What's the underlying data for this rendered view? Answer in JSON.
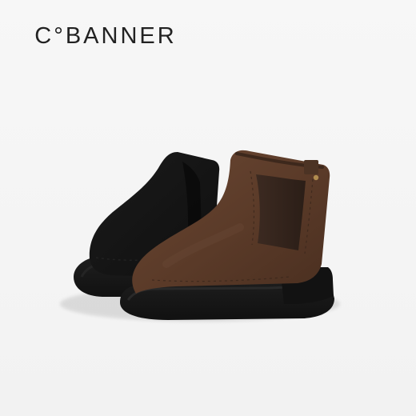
{
  "brand": {
    "logo_text": "C°BANNER"
  },
  "photo": {
    "subject": "product-photo",
    "background_color": "#f6f6f6",
    "boot_colors": {
      "black": "#121212",
      "brown": "#5a3a28",
      "sole": "#1a1a1a"
    }
  }
}
